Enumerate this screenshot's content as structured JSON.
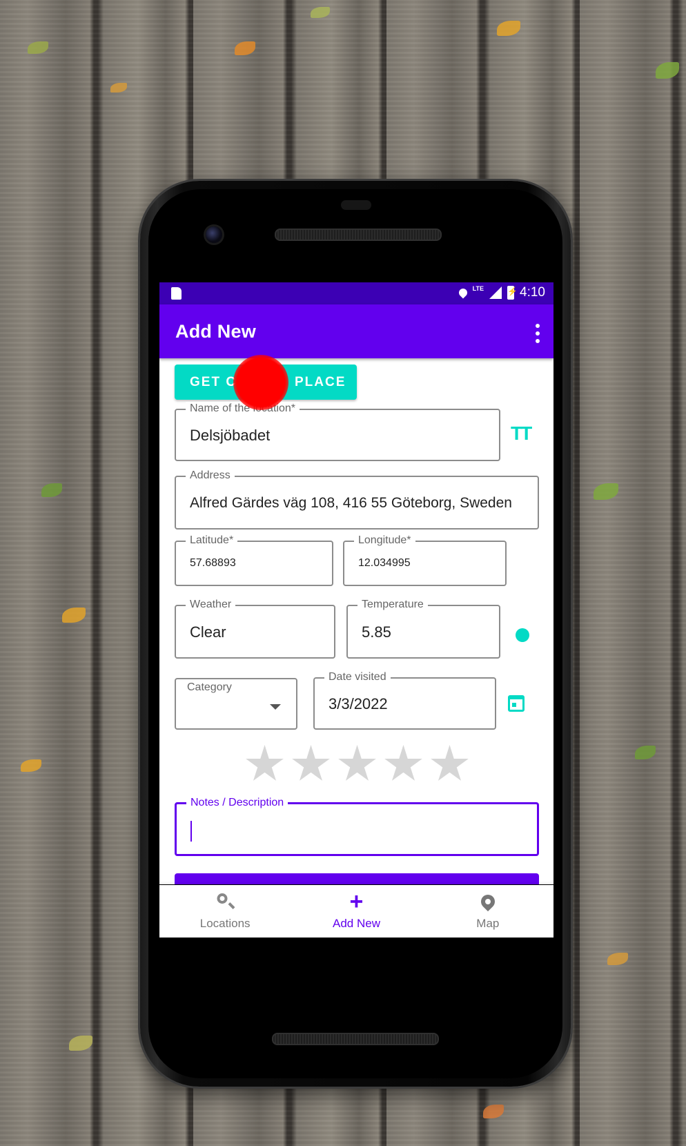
{
  "status_bar": {
    "time": "4:10",
    "network": "LTE",
    "icons": [
      "sd-card-icon",
      "location-icon",
      "signal-icon",
      "battery-charging-icon"
    ]
  },
  "app_bar": {
    "title": "Add New",
    "menu_icon": "more-vert-icon"
  },
  "get_place_button": {
    "label_left": "GET C",
    "label_right": "PLACE"
  },
  "form": {
    "name": {
      "label": "Name of the location*",
      "value": "Delsjöbadet",
      "icon": "text-size-icon"
    },
    "address": {
      "label": "Address",
      "value": "Alfred Gärdes väg 108, 416 55 Göteborg, Sweden"
    },
    "latitude": {
      "label": "Latitude*",
      "value": "57.68893"
    },
    "longitude": {
      "label": "Longitude*",
      "value": "12.034995"
    },
    "weather": {
      "label": "Weather",
      "value": "Clear"
    },
    "temperature": {
      "label": "Temperature",
      "value": "5.85",
      "icon": "sun-icon"
    },
    "category": {
      "label": "Category",
      "value": ""
    },
    "date_visited": {
      "label": "Date visited",
      "value": "3/3/2022",
      "icon": "calendar-icon"
    },
    "rating": {
      "max": 5,
      "value": 0
    },
    "notes": {
      "label": "Notes / Description",
      "value": ""
    }
  },
  "bottom_nav": [
    {
      "label": "Locations",
      "icon": "search-icon",
      "active": false
    },
    {
      "label": "Add New",
      "icon": "plus-icon",
      "active": true
    },
    {
      "label": "Map",
      "icon": "map-pin-icon",
      "active": false
    }
  ],
  "colors": {
    "primary": "#6200ee",
    "primary_dark": "#3c00b4",
    "accent": "#03dac5",
    "touch_indicator": "#ff0000"
  }
}
